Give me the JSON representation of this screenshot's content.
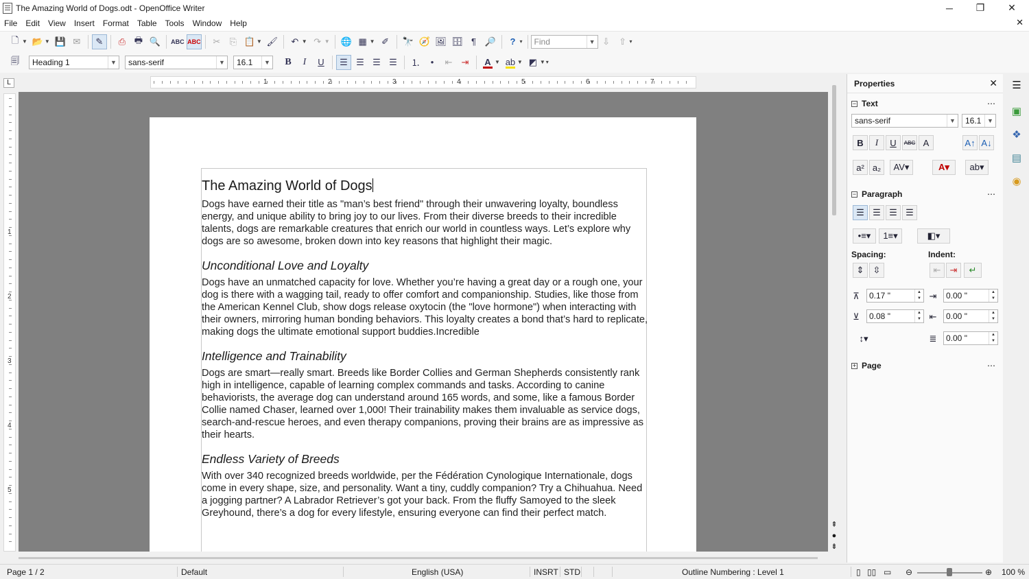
{
  "window": {
    "title": "The Amazing World of Dogs.odt - OpenOffice Writer",
    "minimize": "─",
    "maximize": "❐",
    "close": "✕"
  },
  "menu": [
    "File",
    "Edit",
    "View",
    "Insert",
    "Format",
    "Table",
    "Tools",
    "Window",
    "Help"
  ],
  "doc_close": "✕",
  "toolbar": {
    "find_placeholder": "Find",
    "paragraph_style": "Heading 1",
    "font_name": "sans-serif",
    "font_size": "16.1"
  },
  "ruler": {
    "h_numbers": [
      "1",
      "2",
      "3",
      "4",
      "5",
      "6",
      "7"
    ],
    "v_numbers": [
      "1",
      "2",
      "3",
      "4",
      "5"
    ]
  },
  "document": {
    "title": "The Amazing World of Dogs",
    "intro": "Dogs have earned their title as \"man’s best friend\" through their unwavering loyalty, boundless energy, and unique ability to bring joy to our lives. From their diverse breeds to their incredible talents, dogs are remarkable creatures that enrich our world in countless ways. Let’s explore why dogs are so awesome, broken down into key reasons that highlight their magic.",
    "sections": [
      {
        "heading": "Unconditional Love and Loyalty",
        "body": "Dogs have an unmatched capacity for love. Whether you’re having a great day or a rough one, your dog is there with a wagging tail, ready to offer comfort and companionship. Studies, like those from the American Kennel Club, show dogs release oxytocin (the \"love hormone\") when interacting with their owners, mirroring human bonding behaviors. This loyalty creates a bond that’s hard to replicate, making dogs the ultimate emotional support buddies.Incredible"
      },
      {
        "heading": "Intelligence and Trainability",
        "body": "Dogs are smart—really smart. Breeds like Border Collies and German Shepherds consistently rank high in intelligence, capable of learning complex commands and tasks. According to canine behaviorists, the average dog can understand around 165 words, and some, like a famous Border Collie named Chaser, learned over 1,000! Their trainability makes them invaluable as service dogs, search-and-rescue heroes, and even therapy companions, proving their brains are as impressive as their hearts."
      },
      {
        "heading": "Endless Variety of Breeds",
        "body": "With over 340 recognized breeds worldwide, per the Fédération Cynologique Internationale, dogs come in every shape, size, and personality. Want a tiny, cuddly companion? Try a Chihuahua. Need a jogging partner? A Labrador Retriever’s got your back. From the fluffy Samoyed to the sleek Greyhound, there’s a dog for every lifestyle, ensuring everyone can find their perfect match."
      }
    ]
  },
  "sidebar": {
    "title": "Properties",
    "text_section": "Text",
    "font_name": "sans-serif",
    "font_size": "16.1",
    "paragraph_section": "Paragraph",
    "spacing_label": "Spacing:",
    "indent_label": "Indent:",
    "above_spacing": "0.17 \"",
    "below_spacing": "0.08 \"",
    "before_indent": "0.00 \"",
    "after_indent": "0.00 \"",
    "first_line_indent": "0.00 \"",
    "page_section": "Page",
    "more": "⋯"
  },
  "status": {
    "page": "Page 1 / 2",
    "page_style": "Default",
    "language": "English (USA)",
    "insert_mode": "INSRT",
    "selection_mode": "STD",
    "outline": "Outline Numbering : Level 1",
    "zoom": "100 %"
  },
  "colors": {
    "font_color": "#c00000",
    "highlight": "#f5e100",
    "selection_blue": "#dbe8f5"
  }
}
